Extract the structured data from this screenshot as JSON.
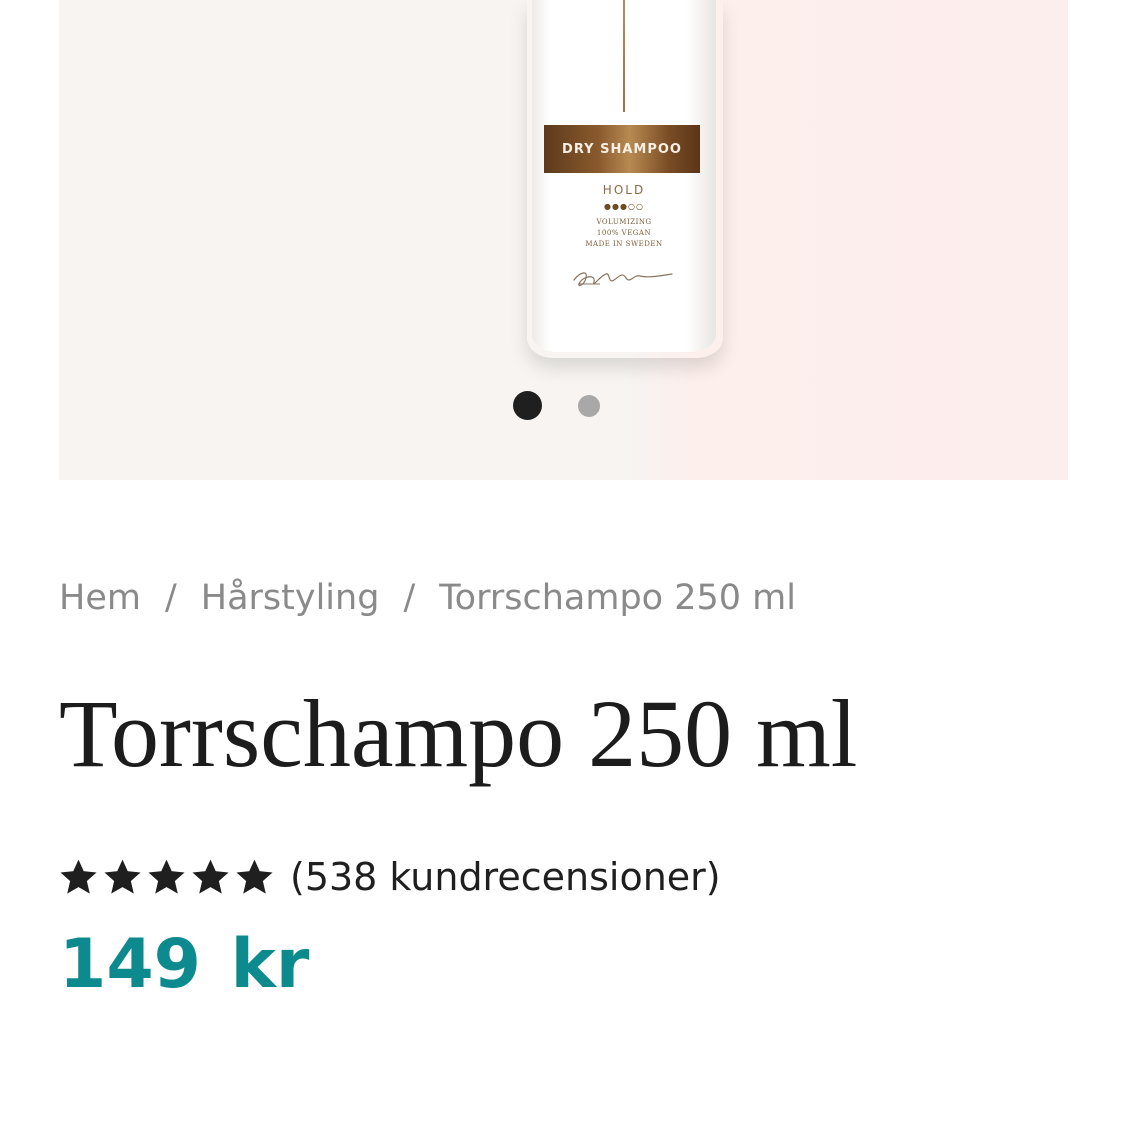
{
  "product_image": {
    "band_text": "DRY SHAMPOO",
    "hold_label": "HOLD",
    "hold_dots": "●●●○○",
    "line1": "VOLUMIZING",
    "line2": "100% VEGAN",
    "line3": "MADE IN SWEDEN"
  },
  "carousel": {
    "total": 2,
    "active_index": 0
  },
  "breadcrumb": {
    "items": [
      "Hem",
      "Hårstyling",
      "Torrschampo 250 ml"
    ],
    "separator": "/"
  },
  "product": {
    "title": "Torrschampo 250 ml",
    "rating": 5,
    "rating_max": 5,
    "reviews_text": "(538 kundrecensioner)",
    "price": "149 kr"
  },
  "colors": {
    "price": "#0c8a8e",
    "stars": "#1f1f1f",
    "active_dot": "#1f1f1f",
    "inactive_dot": "#a8a8a8"
  },
  "icons": {
    "star": "star-icon"
  }
}
